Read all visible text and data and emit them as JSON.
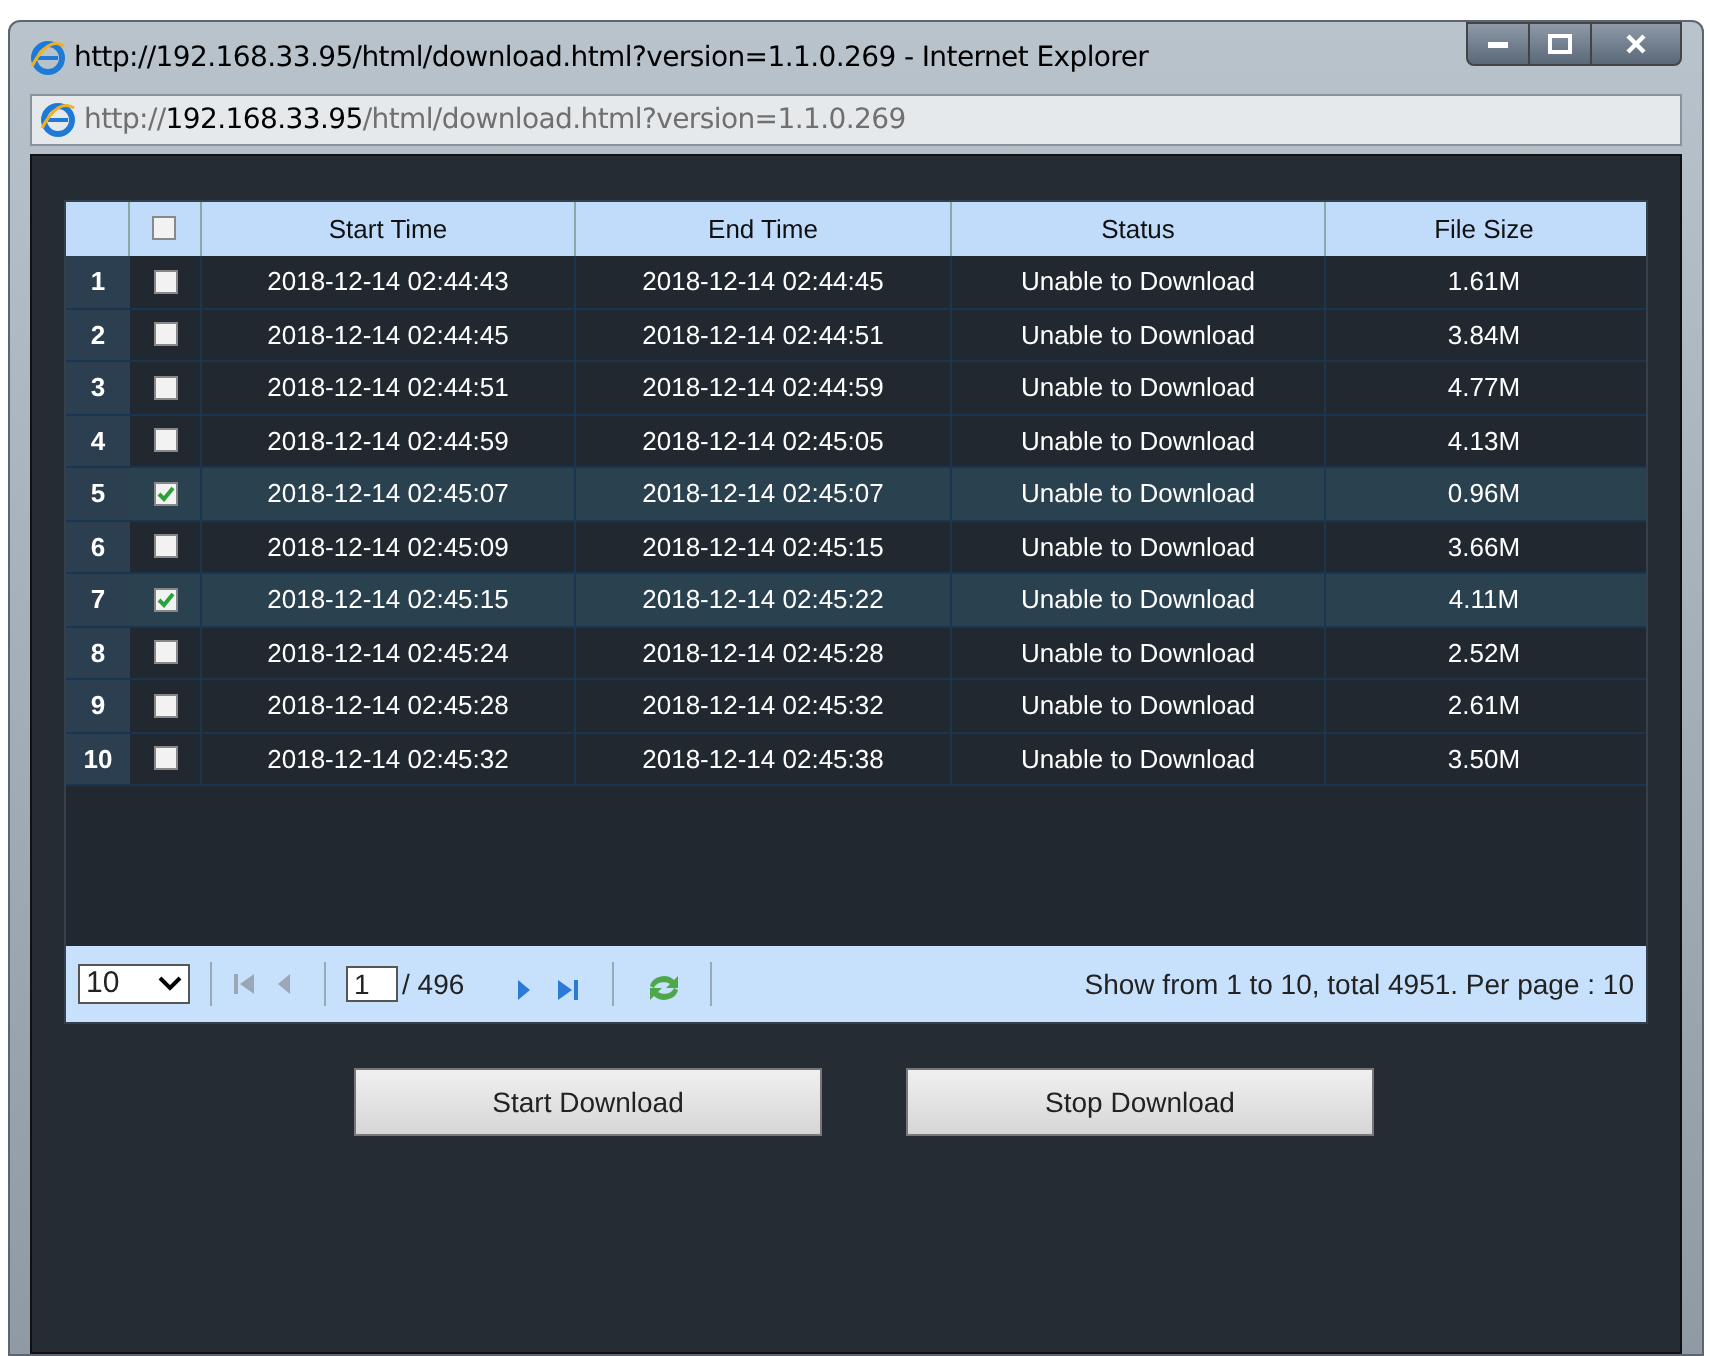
{
  "window": {
    "title": "http://192.168.33.95/html/download.html?version=1.1.0.269 - Internet Explorer"
  },
  "address_bar": {
    "scheme": "http://",
    "host": "192.168.33.95",
    "path": "/html/download.html?version=1.1.0.269"
  },
  "table": {
    "select_all_checked": false,
    "columns": [
      "Start Time",
      "End Time",
      "Status",
      "File Size"
    ],
    "rows": [
      {
        "index": "1",
        "checked": false,
        "start": "2018-12-14 02:44:43",
        "end": "2018-12-14 02:44:45",
        "status": "Unable to Download",
        "size": "1.61M"
      },
      {
        "index": "2",
        "checked": false,
        "start": "2018-12-14 02:44:45",
        "end": "2018-12-14 02:44:51",
        "status": "Unable to Download",
        "size": "3.84M"
      },
      {
        "index": "3",
        "checked": false,
        "start": "2018-12-14 02:44:51",
        "end": "2018-12-14 02:44:59",
        "status": "Unable to Download",
        "size": "4.77M"
      },
      {
        "index": "4",
        "checked": false,
        "start": "2018-12-14 02:44:59",
        "end": "2018-12-14 02:45:05",
        "status": "Unable to Download",
        "size": "4.13M"
      },
      {
        "index": "5",
        "checked": true,
        "start": "2018-12-14 02:45:07",
        "end": "2018-12-14 02:45:07",
        "status": "Unable to Download",
        "size": "0.96M"
      },
      {
        "index": "6",
        "checked": false,
        "start": "2018-12-14 02:45:09",
        "end": "2018-12-14 02:45:15",
        "status": "Unable to Download",
        "size": "3.66M"
      },
      {
        "index": "7",
        "checked": true,
        "start": "2018-12-14 02:45:15",
        "end": "2018-12-14 02:45:22",
        "status": "Unable to Download",
        "size": "4.11M"
      },
      {
        "index": "8",
        "checked": false,
        "start": "2018-12-14 02:45:24",
        "end": "2018-12-14 02:45:28",
        "status": "Unable to Download",
        "size": "2.52M"
      },
      {
        "index": "9",
        "checked": false,
        "start": "2018-12-14 02:45:28",
        "end": "2018-12-14 02:45:32",
        "status": "Unable to Download",
        "size": "2.61M"
      },
      {
        "index": "10",
        "checked": false,
        "start": "2018-12-14 02:45:32",
        "end": "2018-12-14 02:45:38",
        "status": "Unable to Download",
        "size": "3.50M"
      }
    ]
  },
  "pager": {
    "per_page_select": "10",
    "page": "1",
    "total_pages": "/ 496",
    "summary": "Show from 1 to 10, total 4951. Per page : 10"
  },
  "buttons": [
    "Start Download",
    "Stop Download"
  ]
}
